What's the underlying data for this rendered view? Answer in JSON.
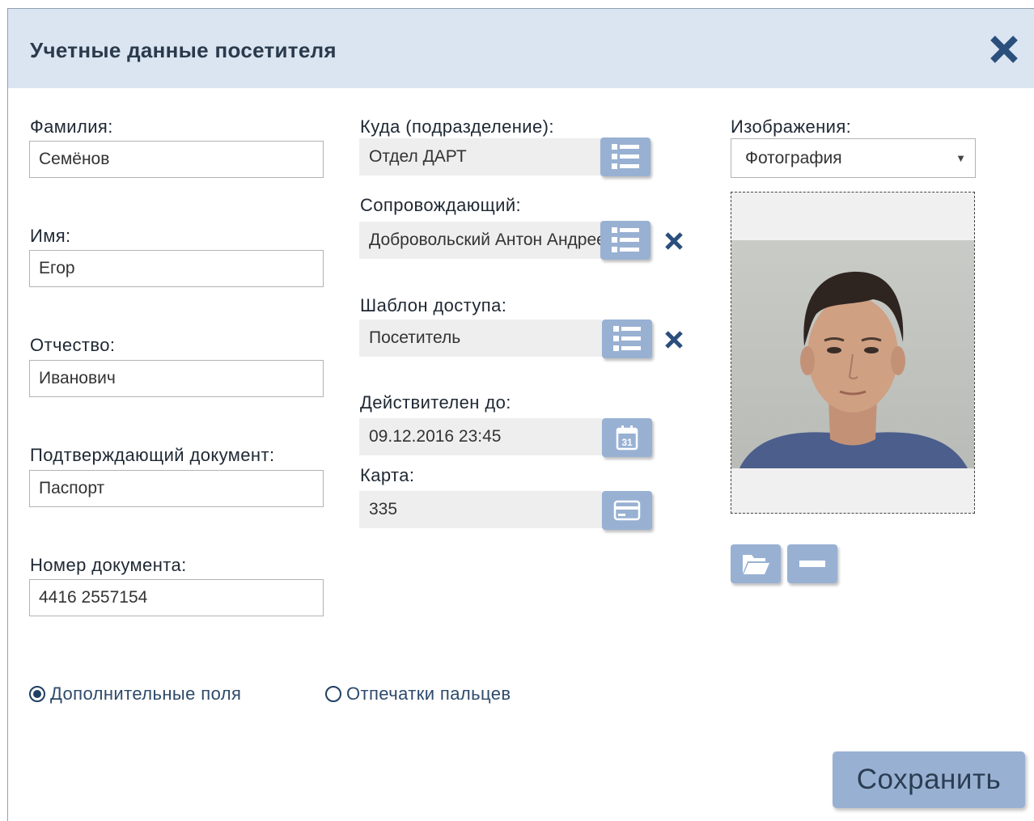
{
  "dialog": {
    "title": "Учетные данные посетителя"
  },
  "left": {
    "surname_label": "Фамилия:",
    "surname_value": "Семёнов",
    "name_label": "Имя:",
    "name_value": "Егор",
    "patronymic_label": "Отчество:",
    "patronymic_value": "Иванович",
    "doc_label": "Подтверждающий документ:",
    "doc_value": "Паспорт",
    "doc_number_label": "Номер документа:",
    "doc_number_value": "4416 2557154"
  },
  "middle": {
    "dept_label": "Куда (подразделение):",
    "dept_value": "Отдел ДАРТ",
    "escort_label": "Сопровождающий:",
    "escort_value": "Добровольский Антон Андреевич",
    "template_label": "Шаблон доступа:",
    "template_value": "Посетитель",
    "valid_label": "Действителен до:",
    "valid_value": "09.12.2016 23:45",
    "card_label": "Карта:",
    "card_value": "335"
  },
  "right": {
    "images_label": "Изображения:",
    "images_selected": "Фотография"
  },
  "bottom": {
    "radio_extra": "Дополнительные поля",
    "radio_fingerprints": "Отпечатки пальцев",
    "save_label": "Сохранить"
  },
  "colors": {
    "titlebar": "#dae5f1",
    "button": "#98b1d3",
    "accent": "#2a4f7d"
  },
  "icons": {
    "close": "close-icon",
    "list": "list-icon",
    "calendar": "calendar-icon",
    "card": "card-icon",
    "folder": "folder-icon",
    "minus": "minus-icon"
  }
}
